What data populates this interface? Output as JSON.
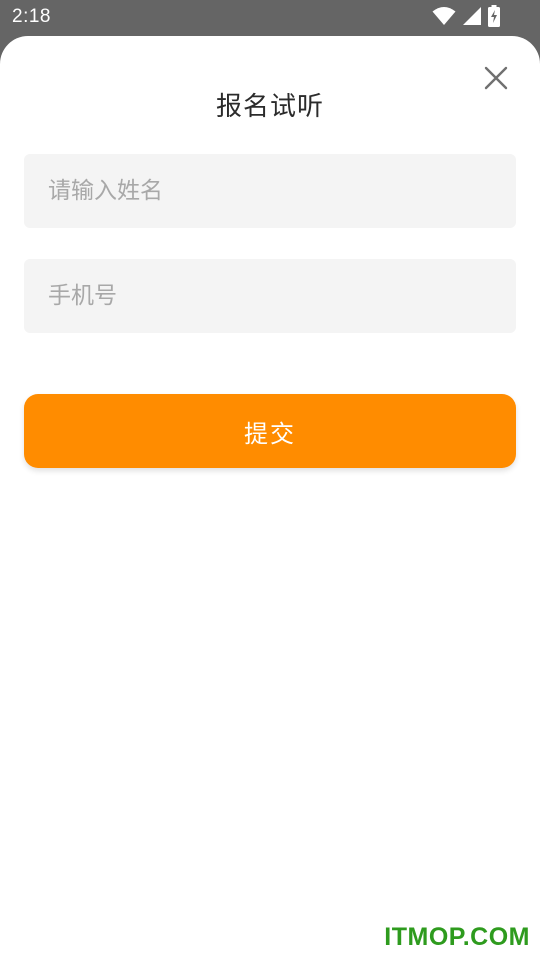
{
  "status_bar": {
    "time": "2:18",
    "icons": [
      "wifi-icon",
      "cell-signal-icon",
      "battery-charging-icon"
    ]
  },
  "dialog": {
    "title": "报名试听",
    "close_icon": "close-icon",
    "fields": {
      "name": {
        "value": "",
        "placeholder": "请输入姓名"
      },
      "phone": {
        "value": "",
        "placeholder": "手机号"
      }
    },
    "submit_label": "提交"
  },
  "watermark": "ITMOP.COM",
  "colors": {
    "accent": "#ff8c00",
    "status_bar": "#656565",
    "field_background": "#f4f4f4",
    "watermark": "#2e9b1e"
  }
}
